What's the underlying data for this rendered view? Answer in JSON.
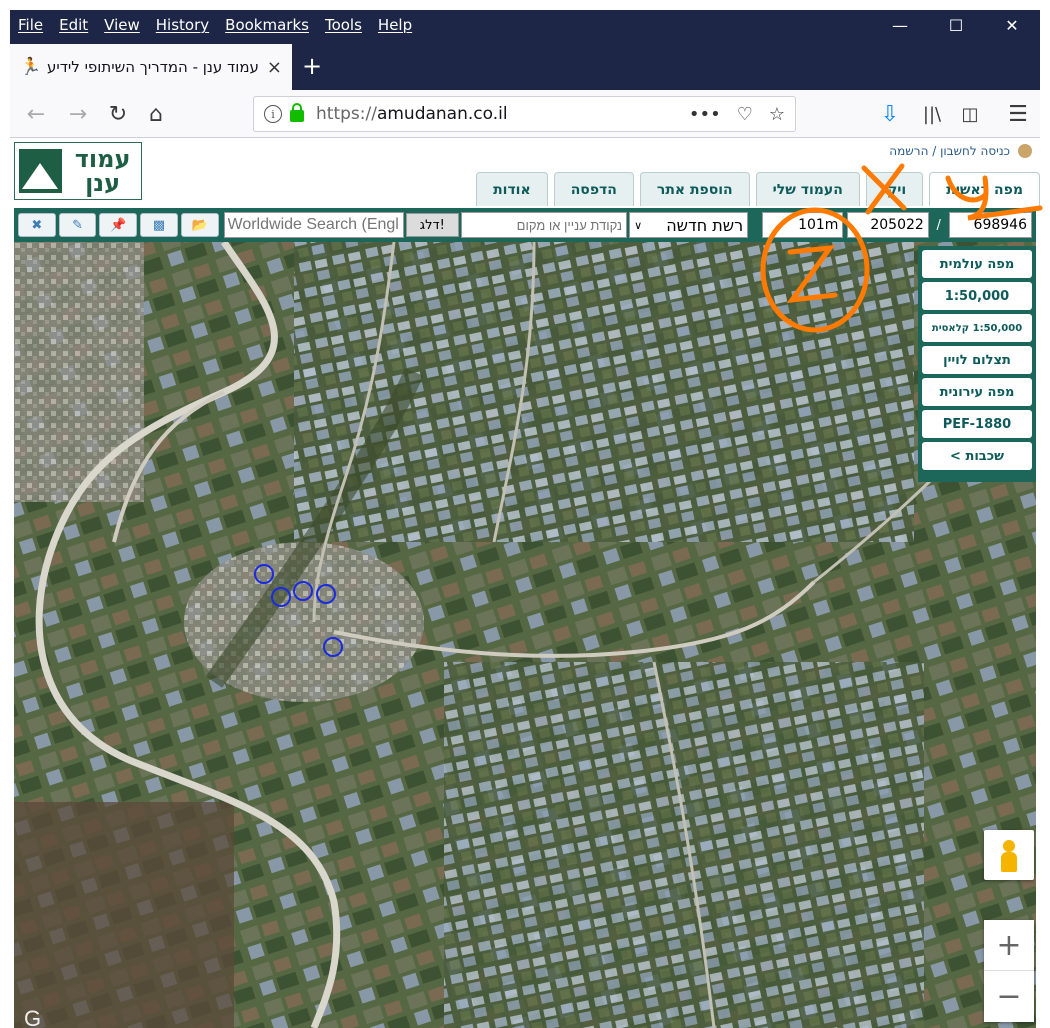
{
  "menubar": {
    "items": [
      "File",
      "Edit",
      "View",
      "History",
      "Bookmarks",
      "Tools",
      "Help"
    ]
  },
  "tab": {
    "title": "עמוד ענן - המדריך השיתופי לידיע",
    "close": "×",
    "new_tab": "+"
  },
  "urlbar": {
    "scheme": "https://",
    "host": "amudanan.co.il",
    "more": "•••"
  },
  "site": {
    "logo_text": "עמוד ענן",
    "login_links": "כניסה לחשבון / הרשמה",
    "nav_tabs": [
      "מפה ראשית",
      "ויקי",
      "העמוד שלי",
      "הוספת אתר",
      "הדפסה",
      "אודות"
    ]
  },
  "toolbar": {
    "search_placeholder": "Worldwide Search (English)",
    "go_label": "דלג!",
    "poi_placeholder": "נקודת עניין או מקום",
    "grid_select": "רשת חדשה",
    "z_value": "101m",
    "y_value": "205022",
    "separator": "/",
    "x_value": "698946"
  },
  "layers": {
    "items": [
      "מפה עולמית",
      "1:50,000",
      "1:50,000 קלאסית",
      "תצלום לויין",
      "מפה עירונית",
      "PEF-1880",
      "שכבות >"
    ]
  },
  "map_controls": {
    "zoom_in": "+",
    "zoom_out": "−"
  },
  "annotations": {
    "x_mark": "X",
    "y_mark": "y",
    "z_mark": "Z"
  },
  "colors": {
    "accent": "#1c665a",
    "annotation": "#ff7a00",
    "marker": "#1a2be0"
  }
}
